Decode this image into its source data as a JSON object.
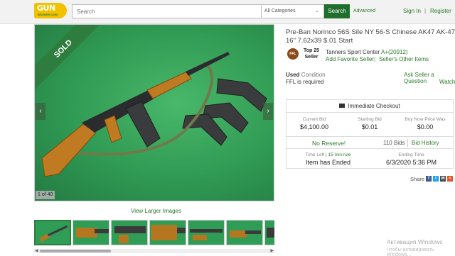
{
  "header": {
    "logo_line1": "GUN",
    "logo_line2": "BROKER.COM",
    "search_placeholder": "Search",
    "category": "All Categories",
    "search_button": "Search",
    "advanced": "Advanced",
    "sign_in": "Sign In",
    "separator": "|",
    "register": "Register"
  },
  "gallery": {
    "sold_label": "SOLD",
    "counter": "1 of 40",
    "view_larger": "View Larger Images",
    "nav_prev": "‹",
    "nav_next": "›"
  },
  "listing": {
    "title": "Pre-Ban Norinco 56S Sile NY 56-S Chinese AK47 AK-47 16\" 7.62x39 $.01 Start",
    "ffl_badge": "FFL",
    "top25": "Top 25 Seller",
    "seller_name": "Tanners Sport Center",
    "seller_rating": "A+(20912)",
    "add_favorite": "Add Favorite Seller",
    "bar": "|",
    "other_items": "Seller's Other Items",
    "condition_value": "Used",
    "condition_label": "Condition",
    "ffl_required": "FFL is required",
    "ask_seller": "Ask Seller a Question",
    "watch": "Watch"
  },
  "panel": {
    "checkout": "Immediate Checkout",
    "current_bid_label": "Current Bid",
    "current_bid": "$4,100.00",
    "starting_bid_label": "Starting Bid",
    "starting_bid": "$0.01",
    "buy_now_label": "Buy Now Price Was",
    "buy_now": "$0.00",
    "no_reserve": "No Reserve!",
    "bids": "110 Bids",
    "bid_history": "Bid History",
    "time_left_label": "Time Left",
    "time_left_sep": "|",
    "min_rule": "15 min rule",
    "time_left": "Item has Ended",
    "ending_time_label": "Ending Time",
    "ending_time": "6/3/2020 5:36 PM"
  },
  "share": {
    "label": "Share",
    "facebook": "f",
    "twitter": "t",
    "email": "✉",
    "plus": "+"
  },
  "os_watermark": {
    "line1": "Активация Windows",
    "line2": "Чтобы активировать Windows..."
  }
}
